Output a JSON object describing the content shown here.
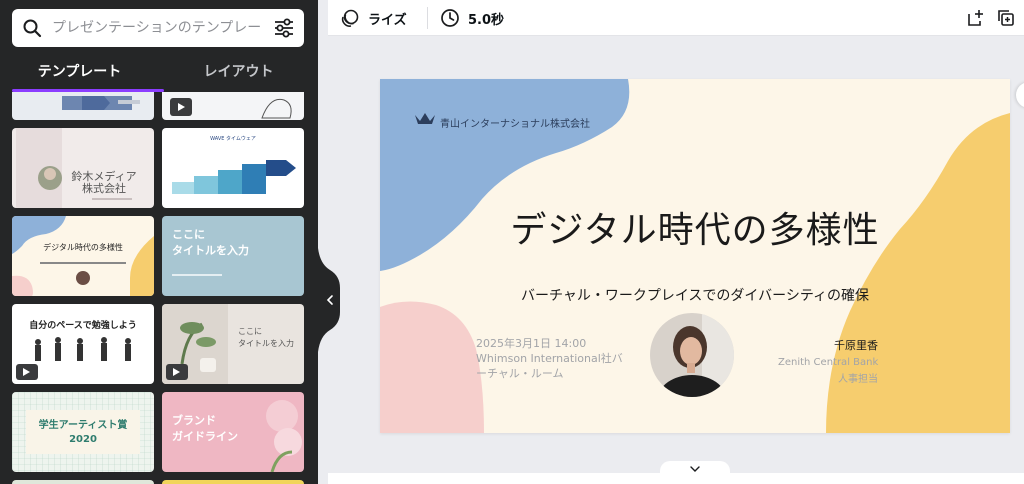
{
  "search": {
    "placeholder": "プレゼンテーションのテンプレートを検索"
  },
  "tabs": [
    {
      "label": "テンプレート",
      "active": true
    },
    {
      "label": "レイアウト",
      "active": false
    }
  ],
  "templates": [
    {
      "id": "top-left-partial"
    },
    {
      "id": "top-right-partial"
    },
    {
      "id": "suzuki-media",
      "lines": [
        "鈴木メディア",
        "株式会社"
      ]
    },
    {
      "id": "steps",
      "heading": "WAVE タイムウェア"
    },
    {
      "id": "digital-diversity",
      "title": "デジタル時代の多様性"
    },
    {
      "id": "koko-title-blue",
      "lines": [
        "ここに",
        "タイトルを入力"
      ]
    },
    {
      "id": "study-pace",
      "title": "自分のペースで勉強しよう"
    },
    {
      "id": "koko-title-plant",
      "lines": [
        "ここに",
        "タイトルを入力"
      ]
    },
    {
      "id": "artist-award",
      "lines": [
        "学生アーティスト賞",
        "2020"
      ]
    },
    {
      "id": "brand-guideline",
      "lines": [
        "ブランド",
        "ガイドライン"
      ]
    }
  ],
  "toolbar": {
    "animation_label": "ライズ",
    "duration_label": "5.0秒"
  },
  "slide": {
    "company": "青山インターナショナル株式会社",
    "title": "デジタル時代の多様性",
    "subtitle": "バーチャル・ワークプレイスでのダイバーシティの確保",
    "datetime": "2025年3月1日 14:00 Whimson International社バーチャル・ルーム",
    "presenter_name": "千原里香",
    "presenter_company": "Zenith Central Bank",
    "presenter_role": "人事担当",
    "colors": {
      "blue": "#8eb1d9",
      "yellow": "#f6cd6e",
      "pink": "#f6cfcc",
      "cream": "#fdf6e8"
    }
  },
  "accent": "#8b3dff"
}
